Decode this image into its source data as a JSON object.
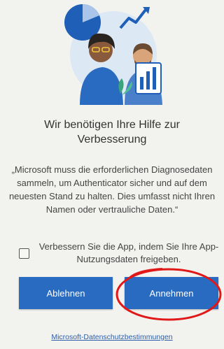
{
  "dialog": {
    "title": "Wir benötigen Ihre Hilfe zur Verbesserung",
    "body": "„Microsoft muss die erforderlichen Diagnosedaten sammeln, um Authenticator sicher und auf dem neuesten Stand zu halten. Dies umfasst nicht Ihren Namen oder vertrauliche Daten.“",
    "checkbox_checked": false,
    "checkbox_label": "Verbessern Sie die App, indem Sie Ihre App-Nutzungsdaten freigeben.",
    "decline_label": "Ablehnen",
    "accept_label": "Annehmen",
    "privacy_link": "Microsoft-Datenschutzbestimmungen"
  },
  "colors": {
    "primary": "#2a6bc2",
    "annotation": "#e01818",
    "link": "#2e5fa8"
  },
  "illustration": {
    "icons": [
      "pie-chart-icon",
      "trend-arrow-icon",
      "bar-chart-icon",
      "person-icon"
    ]
  }
}
